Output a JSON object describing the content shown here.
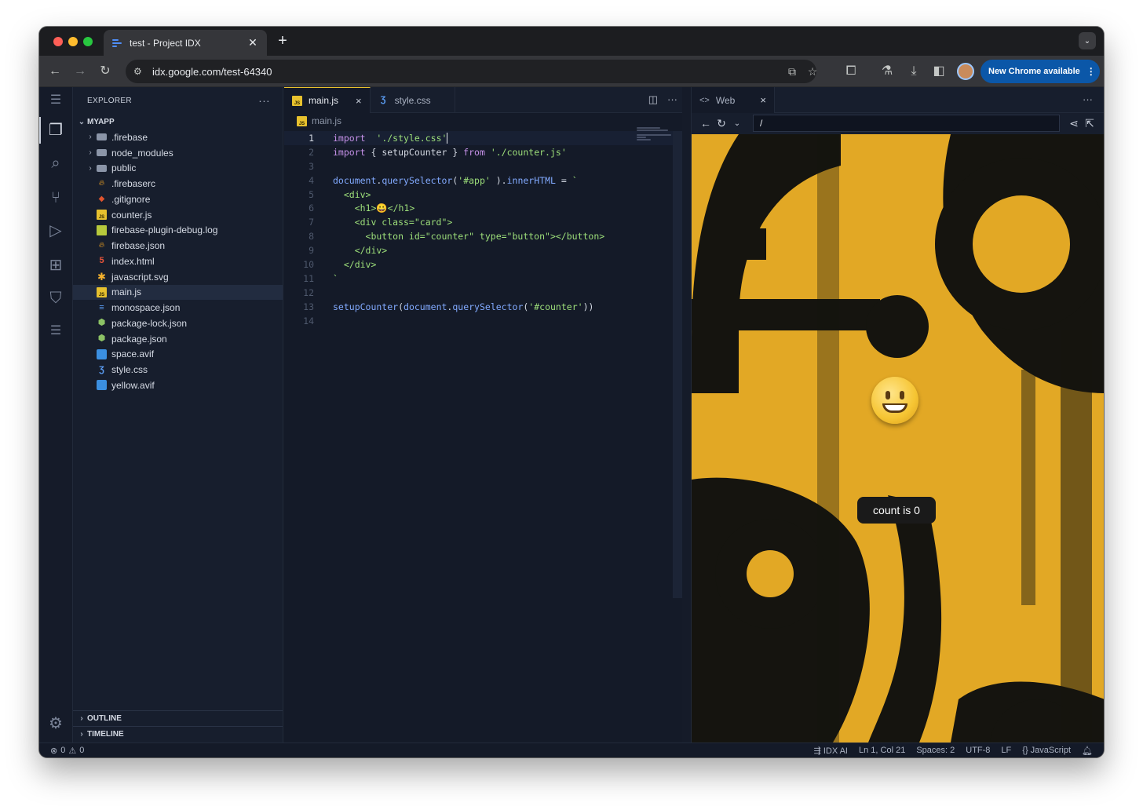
{
  "browser": {
    "tab_title": "test - Project IDX",
    "new_tab": "+",
    "tab_menu": "⌄",
    "url": "idx.google.com/test-64340",
    "update_label": "New Chrome available",
    "update_menu": "⋮"
  },
  "explorer": {
    "title": "EXPLORER",
    "more": "···",
    "root": "MYAPP",
    "items": [
      {
        "name": ".firebase",
        "type": "folder"
      },
      {
        "name": "node_modules",
        "type": "folder"
      },
      {
        "name": "public",
        "type": "folder"
      },
      {
        "name": ".firebaserc",
        "type": "firebase"
      },
      {
        "name": ".gitignore",
        "type": "git"
      },
      {
        "name": "counter.js",
        "type": "js"
      },
      {
        "name": "firebase-plugin-debug.log",
        "type": "log"
      },
      {
        "name": "firebase.json",
        "type": "firebase"
      },
      {
        "name": "index.html",
        "type": "html"
      },
      {
        "name": "javascript.svg",
        "type": "svg"
      },
      {
        "name": "main.js",
        "type": "js",
        "selected": true
      },
      {
        "name": "monospace.json",
        "type": "mono"
      },
      {
        "name": "package-lock.json",
        "type": "npm"
      },
      {
        "name": "package.json",
        "type": "npm"
      },
      {
        "name": "space.avif",
        "type": "image"
      },
      {
        "name": "style.css",
        "type": "css"
      },
      {
        "name": "yellow.avif",
        "type": "image"
      }
    ],
    "outline": "OUTLINE",
    "timeline": "TIMELINE"
  },
  "editor": {
    "tabs": [
      {
        "label": "main.js",
        "icon": "js",
        "active": true,
        "close": "×"
      },
      {
        "label": "style.css",
        "icon": "css",
        "active": false
      }
    ],
    "breadcrumb": "main.js",
    "current_line": 1,
    "lines": [
      {
        "n": "1",
        "tokens": [
          [
            "kw",
            "import"
          ],
          [
            "",
            "  "
          ],
          [
            "str",
            "'./style.css'"
          ]
        ]
      },
      {
        "n": "2",
        "tokens": [
          [
            "kw",
            "import"
          ],
          [
            "",
            " { setupCounter } "
          ],
          [
            "kw",
            "from"
          ],
          [
            "",
            " "
          ],
          [
            "str",
            "'./counter.js'"
          ]
        ]
      },
      {
        "n": "3",
        "tokens": []
      },
      {
        "n": "4",
        "tokens": [
          [
            "fn",
            "document"
          ],
          [
            "",
            "."
          ],
          [
            "fn",
            "querySelector"
          ],
          [
            "",
            "("
          ],
          [
            "str",
            "'#app'"
          ],
          [
            "",
            " )."
          ],
          [
            "fn",
            "innerHTML"
          ],
          [
            "",
            " = "
          ],
          [
            "str",
            "`"
          ]
        ]
      },
      {
        "n": "5",
        "tokens": [
          [
            "tag",
            "  <div>"
          ]
        ]
      },
      {
        "n": "6",
        "tokens": [
          [
            "tag",
            "    <h1>😀</h1>"
          ]
        ]
      },
      {
        "n": "7",
        "tokens": [
          [
            "tag",
            "    <div class=\"card\">"
          ]
        ]
      },
      {
        "n": "8",
        "tokens": [
          [
            "tag",
            "      <button id=\"counter\" type=\"button\"></button>"
          ]
        ]
      },
      {
        "n": "9",
        "tokens": [
          [
            "tag",
            "    </div>"
          ]
        ]
      },
      {
        "n": "10",
        "tokens": [
          [
            "tag",
            "  </div>"
          ]
        ]
      },
      {
        "n": "11",
        "tokens": [
          [
            "str",
            "`"
          ]
        ]
      },
      {
        "n": "12",
        "tokens": []
      },
      {
        "n": "13",
        "tokens": [
          [
            "fn",
            "setupCounter"
          ],
          [
            "",
            "("
          ],
          [
            "fn",
            "document"
          ],
          [
            "",
            "."
          ],
          [
            "fn",
            "querySelector"
          ],
          [
            "",
            "("
          ],
          [
            "str",
            "'#counter'"
          ],
          [
            "",
            "))"
          ]
        ]
      },
      {
        "n": "14",
        "tokens": []
      }
    ]
  },
  "web_preview": {
    "tab_label": "Web",
    "close": "×",
    "more": "···",
    "url": "/",
    "counter_label": "count is 0",
    "bg_color": "#e2a825",
    "ink_color": "#15140f"
  },
  "status": {
    "errors": "0",
    "warnings": "0",
    "idx_ai": "IDX AI",
    "position": "Ln 1, Col 21",
    "spaces": "Spaces: 2",
    "encoding": "UTF-8",
    "eol": "LF",
    "language": "JavaScript"
  }
}
